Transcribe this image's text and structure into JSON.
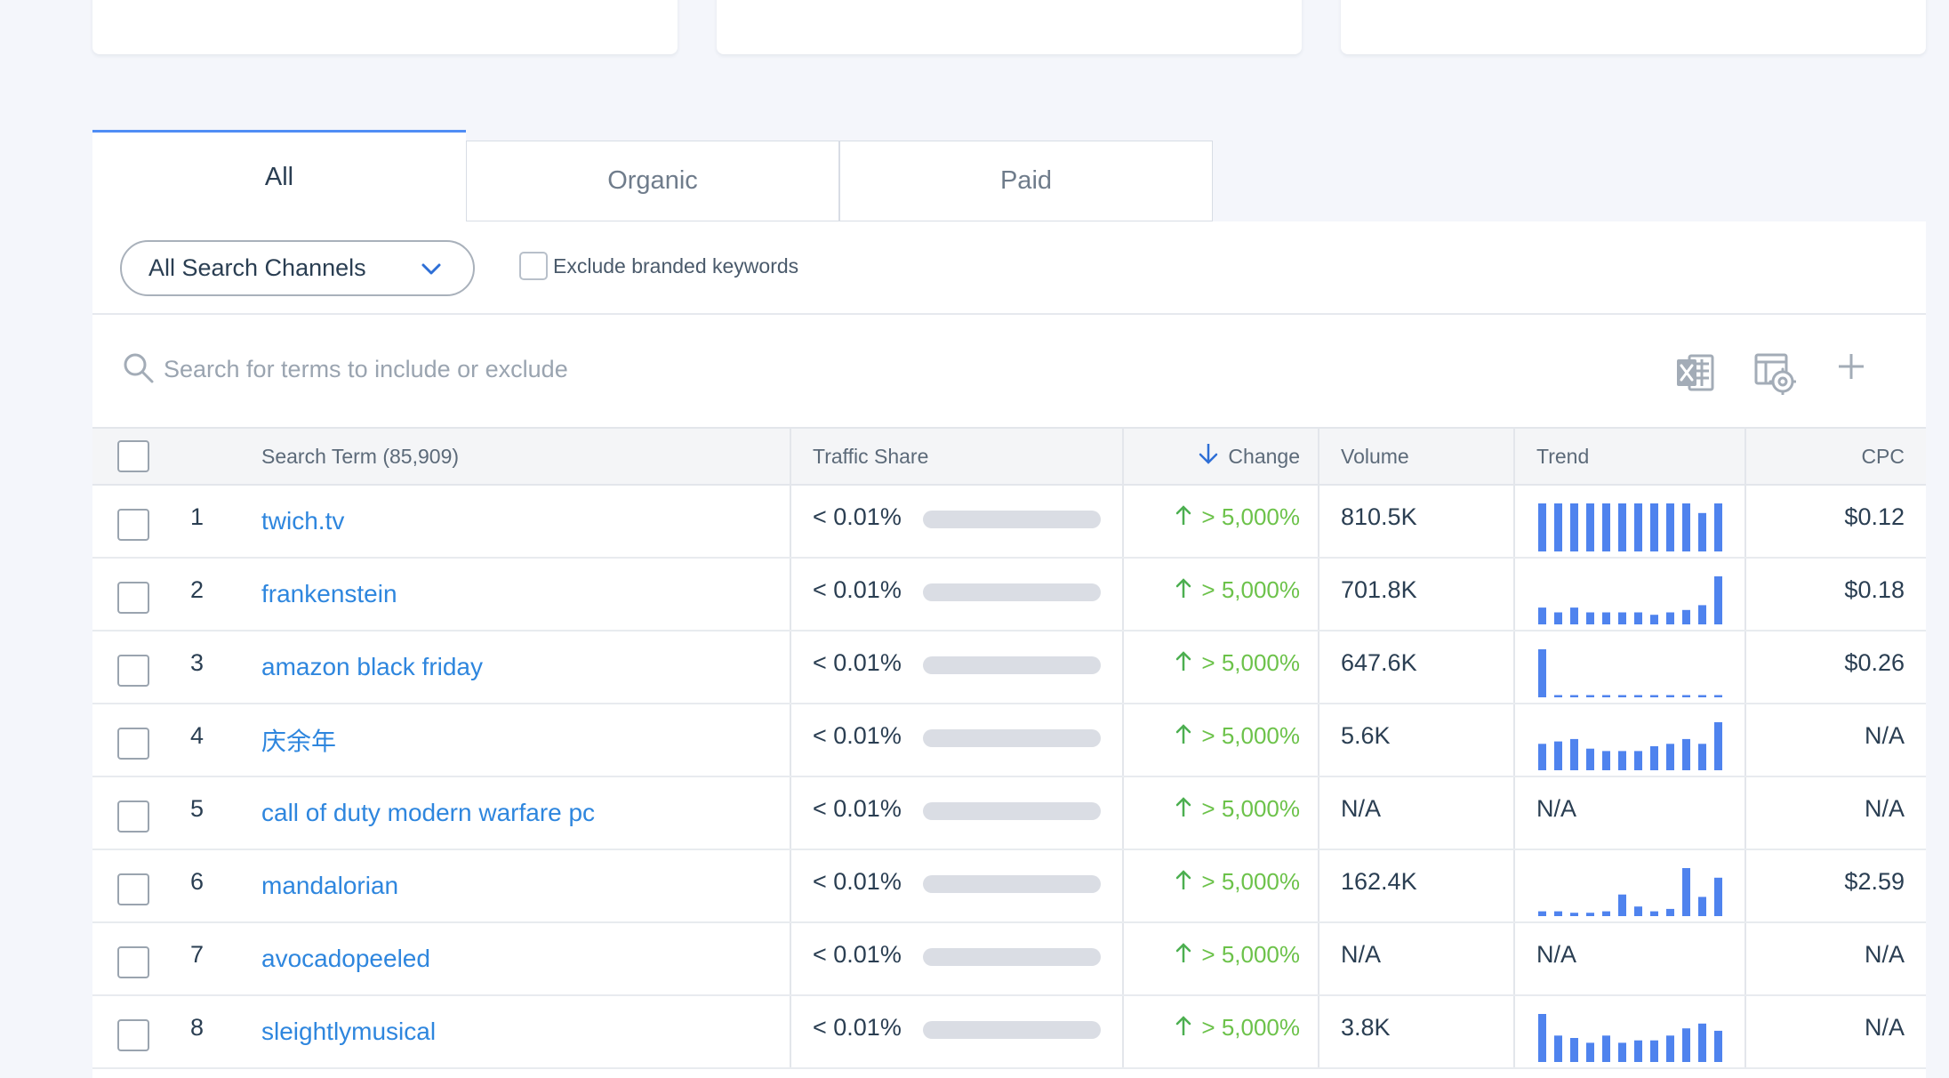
{
  "tabs": [
    {
      "label": "All",
      "active": true
    },
    {
      "label": "Organic",
      "active": false
    },
    {
      "label": "Paid",
      "active": false
    }
  ],
  "filters": {
    "channel_dropdown": "All Search Channels",
    "exclude_branded_label": "Exclude branded keywords"
  },
  "search": {
    "placeholder": "Search for terms to include or exclude"
  },
  "toolbar_icons": [
    "excel-export-icon",
    "column-settings-icon",
    "add-icon"
  ],
  "colors": {
    "link": "#2e86de",
    "positive_change": "#6cc24a",
    "trend_bar": "#4f83ee",
    "active_tab_border": "#4f8df5"
  },
  "table": {
    "headers": {
      "search_term": "Search Term (85,909)",
      "traffic_share": "Traffic Share",
      "change": "Change",
      "volume": "Volume",
      "trend": "Trend",
      "cpc": "CPC"
    },
    "rows": [
      {
        "rank": "1",
        "term": "twich.tv",
        "share": "< 0.01%",
        "change": "> 5,000%",
        "volume": "810.5K",
        "trend": [
          10,
          10,
          10,
          10,
          10,
          10,
          10,
          10,
          10,
          10,
          8,
          10
        ],
        "cpc": "$0.12"
      },
      {
        "rank": "2",
        "term": "frankenstein",
        "share": "< 0.01%",
        "change": "> 5,000%",
        "volume": "701.8K",
        "trend": [
          3.5,
          2.5,
          3.5,
          2.5,
          2.5,
          2.5,
          2.5,
          2,
          2.5,
          3,
          4,
          10
        ],
        "cpc": "$0.18"
      },
      {
        "rank": "3",
        "term": "amazon black friday",
        "share": "< 0.01%",
        "change": "> 5,000%",
        "volume": "647.6K",
        "trend": [
          10,
          0.3,
          0.3,
          0.3,
          0.3,
          0.3,
          0.3,
          0.3,
          0.3,
          0.3,
          0.3,
          0.3
        ],
        "cpc": "$0.26"
      },
      {
        "rank": "4",
        "term": "庆余年",
        "share": "< 0.01%",
        "change": "> 5,000%",
        "volume": "5.6K",
        "trend": [
          5.5,
          6,
          6.5,
          4.5,
          4,
          4,
          4,
          5,
          5.5,
          6.5,
          5.5,
          10
        ],
        "cpc": "N/A"
      },
      {
        "rank": "5",
        "term": "call of duty modern warfare pc",
        "share": "< 0.01%",
        "change": "> 5,000%",
        "volume": "N/A",
        "trend": "N/A",
        "cpc": "N/A"
      },
      {
        "rank": "6",
        "term": "mandalorian",
        "share": "< 0.01%",
        "change": "> 5,000%",
        "volume": "162.4K",
        "trend": [
          1,
          1,
          0.7,
          0.7,
          1,
          4.5,
          2,
          1,
          1.5,
          10,
          4,
          8
        ],
        "cpc": "$2.59"
      },
      {
        "rank": "7",
        "term": "avocadopeeled",
        "share": "< 0.01%",
        "change": "> 5,000%",
        "volume": "N/A",
        "trend": "N/A",
        "cpc": "N/A"
      },
      {
        "rank": "8",
        "term": "sleightlymusical",
        "share": "< 0.01%",
        "change": "> 5,000%",
        "volume": "3.8K",
        "trend": [
          10,
          5.5,
          5,
          4,
          5.5,
          4,
          4.5,
          4.5,
          5.5,
          7,
          8,
          6.5
        ],
        "cpc": "N/A"
      }
    ]
  }
}
